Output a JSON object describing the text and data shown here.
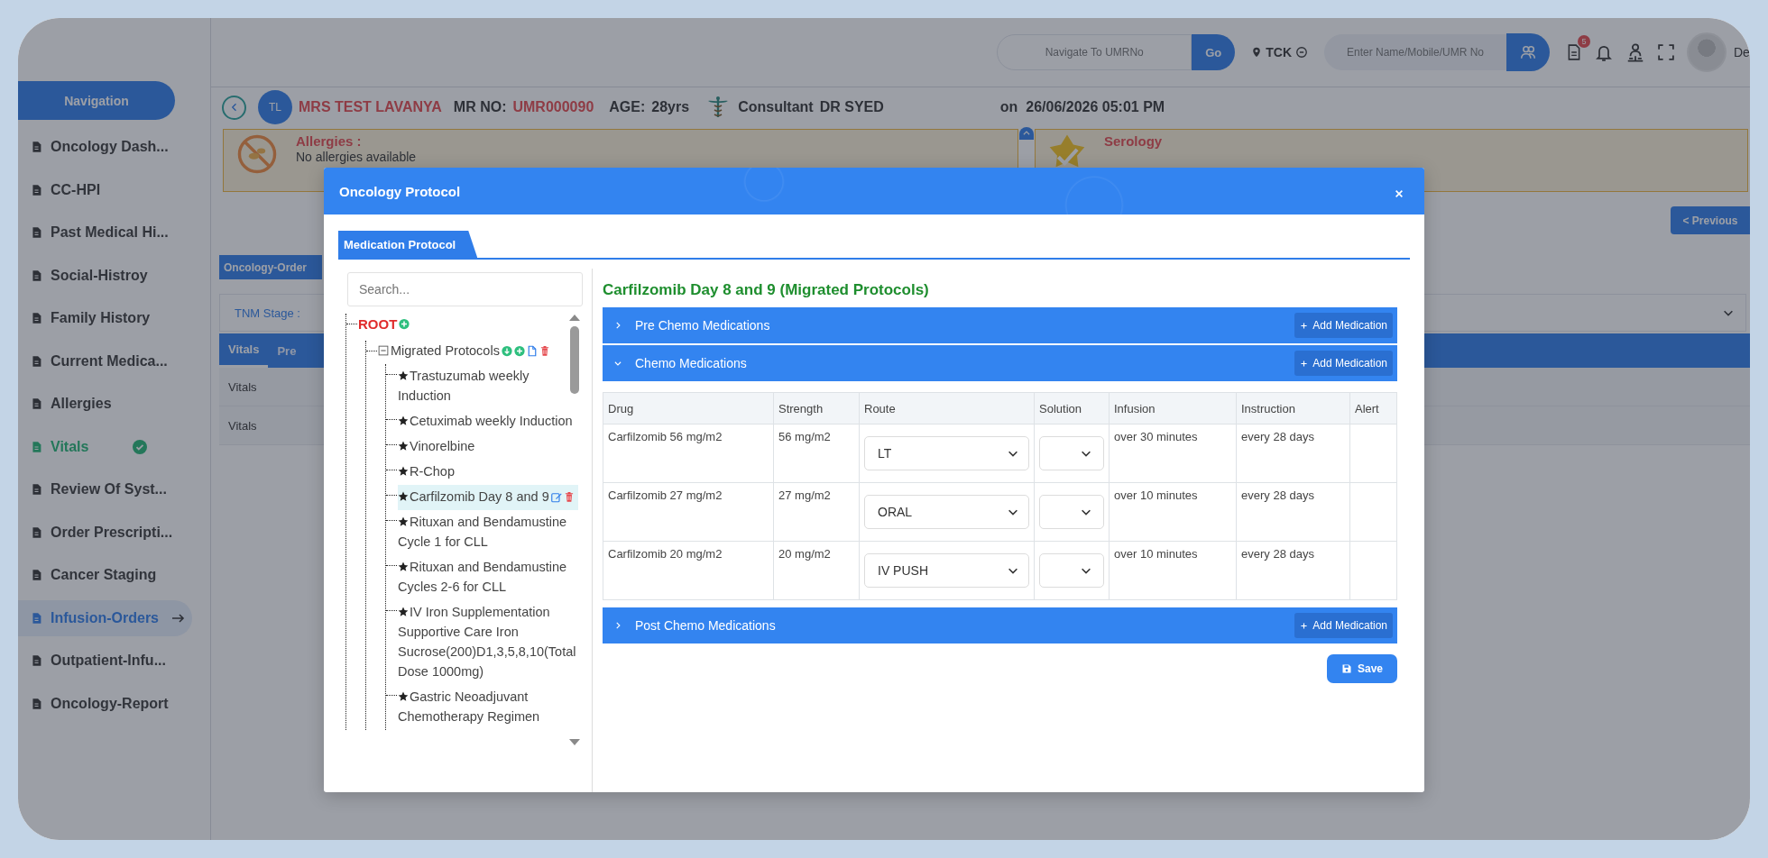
{
  "top_bar": {
    "umr_search": {
      "placeholder": "Navigate To UMRNo"
    },
    "go_button": "Go",
    "location": "TCK",
    "patient_search": {
      "placeholder": "Enter Name/Mobile/UMR No"
    },
    "notification_badge": "5",
    "user_name": "De"
  },
  "sidebar": {
    "title": "Navigation",
    "items": [
      {
        "label": "Oncology Dash...",
        "selected": false,
        "completed": false
      },
      {
        "label": "CC-HPI",
        "selected": false,
        "completed": false
      },
      {
        "label": "Past Medical Hi...",
        "selected": false,
        "completed": false
      },
      {
        "label": "Social-Histroy",
        "selected": false,
        "completed": false
      },
      {
        "label": "Family History",
        "selected": false,
        "completed": false
      },
      {
        "label": "Current Medica...",
        "selected": false,
        "completed": false
      },
      {
        "label": "Allergies",
        "selected": false,
        "completed": false
      },
      {
        "label": "Vitals",
        "selected": false,
        "completed": true
      },
      {
        "label": "Review Of Syst...",
        "selected": false,
        "completed": false
      },
      {
        "label": "Order Prescripti...",
        "selected": false,
        "completed": false
      },
      {
        "label": "Cancer Staging",
        "selected": false,
        "completed": false
      },
      {
        "label": "Infusion-Orders",
        "selected": true,
        "completed": false
      },
      {
        "label": "Outpatient-Infu...",
        "selected": false,
        "completed": false
      },
      {
        "label": "Oncology-Report",
        "selected": false,
        "completed": false
      }
    ]
  },
  "patient": {
    "initials": "TL",
    "name": "MRS TEST LAVANYA",
    "mr_label": "MR NO:",
    "mr_no": "UMR000090",
    "age_label": "AGE:",
    "age": "28yrs",
    "consultant_label": "Consultant",
    "consultant": "DR SYED",
    "date": "on  26/06/2026 05:01 PM"
  },
  "alerts": [
    {
      "kind": "allergies",
      "title": "Allergies :",
      "text": "No allergies available"
    },
    {
      "kind": "serology",
      "title": "Serology"
    }
  ],
  "previous_button": "< Previous",
  "section_tab": "Oncology-Order",
  "stage_field": "TNM Stage :",
  "tabs": [
    {
      "label": "Vitals",
      "selected": true
    },
    {
      "label": "Pre",
      "selected": false
    }
  ],
  "rows": [
    "Vitals",
    "Vitals"
  ],
  "modal": {
    "title": "Oncology Protocol",
    "tabs": [
      {
        "label": "Medication Protocol",
        "selected": true
      }
    ],
    "search": {
      "placeholder": "Search..."
    },
    "tree": {
      "label": "ROOT",
      "kind": "root",
      "children": [
        {
          "label": "Migrated Protocols",
          "kind": "folder",
          "expanded": true,
          "children": [
            {
              "label": "Trastuzumab weekly Induction",
              "kind": "leaf",
              "selected": false
            },
            {
              "label": "Cetuximab weekly Induction",
              "kind": "leaf",
              "selected": false
            },
            {
              "label": "Vinorelbine",
              "kind": "leaf",
              "selected": false
            },
            {
              "label": "R-Chop",
              "kind": "leaf",
              "selected": false
            },
            {
              "label": "Carfilzomib Day 8 and 9",
              "kind": "leaf",
              "selected": true
            },
            {
              "label": "Rituxan and Bendamustine Cycle 1 for CLL",
              "kind": "leaf",
              "selected": false
            },
            {
              "label": "Rituxan and Bendamustine Cycles 2-6 for CLL",
              "kind": "leaf",
              "selected": false
            },
            {
              "label": "IV Iron Supplementation Supportive Care Iron Sucrose(200)D1,3,5,8,10(Total Dose 1000mg)",
              "kind": "leaf",
              "selected": false
            },
            {
              "label": "Gastric Neoadjuvant Chemotherapy Regimen",
              "kind": "leaf",
              "selected": false
            }
          ]
        }
      ]
    },
    "detail": {
      "title": "Carfilzomib Day 8 and 9 (Migrated Protocols)",
      "sections": [
        {
          "title": "Pre Chemo Medications",
          "expanded": false,
          "action": "Add Medication"
        },
        {
          "title": "Chemo Medications",
          "expanded": true,
          "action": "Add Medication",
          "table": {
            "columns": [
              "Drug",
              "Strength",
              "Route",
              "Solution",
              "Infusion",
              "Instruction",
              "Alert"
            ],
            "rows": [
              {
                "drug": "Carfilzomib 56 mg/m2",
                "strength": "56 mg/m2",
                "route": "LT",
                "infusion": "over 30 minutes",
                "instruction": "every 28 days"
              },
              {
                "drug": "Carfilzomib 27 mg/m2",
                "strength": "27 mg/m2",
                "route": "ORAL",
                "infusion": "over 10 minutes",
                "instruction": "every 28 days"
              },
              {
                "drug": "Carfilzomib 20 mg/m2",
                "strength": "20 mg/m2",
                "route": "IV PUSH",
                "infusion": "over 10 minutes",
                "instruction": "every 28 days"
              }
            ]
          }
        },
        {
          "title": "Post Chemo Medications",
          "expanded": false,
          "action": "Add Medication"
        }
      ],
      "save_button": "Save"
    }
  }
}
